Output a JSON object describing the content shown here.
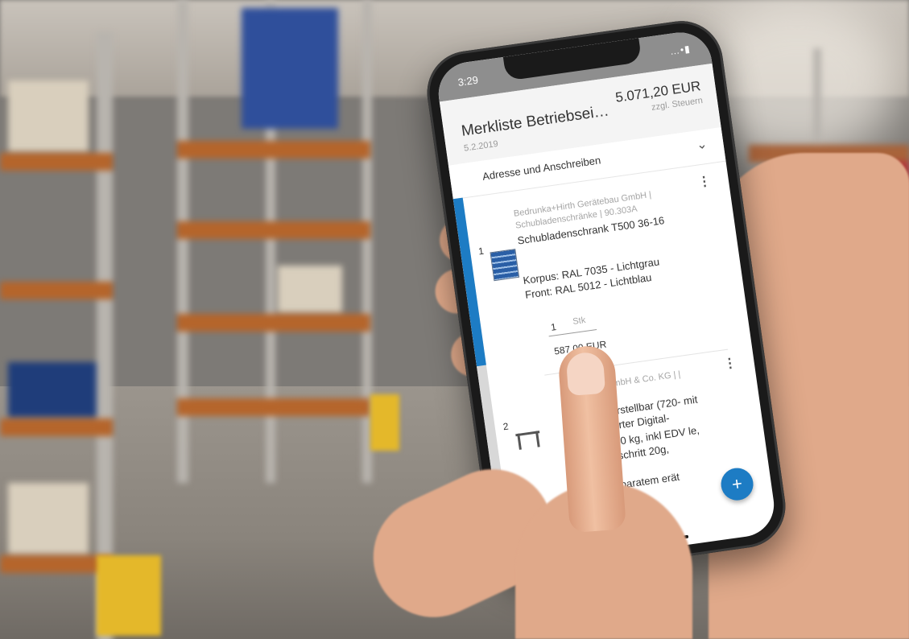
{
  "status": {
    "time": "3:29",
    "icons": "…•▮"
  },
  "header": {
    "title": "Merkliste Betriebseinric...",
    "date": "5.2.2019",
    "total": "5.071,20 EUR",
    "tax_note": "zzgl. Steuern"
  },
  "section": {
    "label": "Adresse und Anschreiben"
  },
  "items": [
    {
      "number": "1",
      "supplier": "Bedrunka+Hirth Gerätebau GmbH | Schubladenschränke | 90.303A",
      "product": "Schubladenschrank T500 36-16",
      "attr1": "Korpus: RAL 7035 - Lichtgrau",
      "attr2": "Front: RAL 5012 - Lichtblau",
      "qty": "1",
      "unit": "Stk",
      "price": "587,00 EUR"
    },
    {
      "number": "2",
      "supplier": "scholz GmbH & Co. KG | | 503842",
      "product": "öhenverstellbar (720- mit integrierter Digital-",
      "attr1": "e, bis 60 kg, inkl EDV le, Ziffernschritt 20g,",
      "attr2": "mit separatem erät"
    }
  ],
  "fab": {
    "label": "+"
  },
  "colors": {
    "accent": "#1d7cc4",
    "status_bar": "#8e8e8e"
  }
}
